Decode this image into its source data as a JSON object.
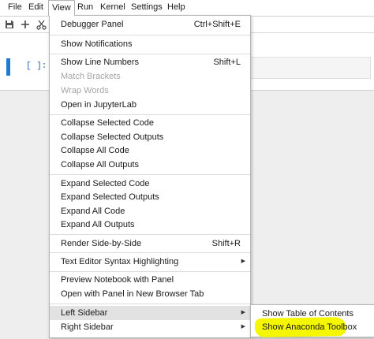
{
  "menubar": {
    "items": [
      "File",
      "Edit",
      "View",
      "Run",
      "Kernel",
      "Settings",
      "Help"
    ],
    "active": "View"
  },
  "toolbar": {
    "buttons": [
      {
        "icon": "save-icon"
      },
      {
        "icon": "plus-icon"
      },
      {
        "icon": "scissors-icon"
      }
    ]
  },
  "notebook": {
    "prompt": "[ ]:"
  },
  "view_menu": {
    "items": [
      {
        "label": "Debugger Panel",
        "shortcut": "Ctrl+Shift+E"
      },
      {
        "label": "Show Notifications"
      },
      {
        "label": "Show Line Numbers",
        "shortcut": "Shift+L"
      },
      {
        "label": "Match Brackets",
        "disabled": true
      },
      {
        "label": "Wrap Words",
        "disabled": true
      },
      {
        "label": "Open in JupyterLab"
      },
      {
        "label": "Collapse Selected Code"
      },
      {
        "label": "Collapse Selected Outputs"
      },
      {
        "label": "Collapse All Code"
      },
      {
        "label": "Collapse All Outputs"
      },
      {
        "label": "Expand Selected Code"
      },
      {
        "label": "Expand Selected Outputs"
      },
      {
        "label": "Expand All Code"
      },
      {
        "label": "Expand All Outputs"
      },
      {
        "label": "Render Side-by-Side",
        "shortcut": "Shift+R"
      },
      {
        "label": "Text Editor Syntax Highlighting",
        "submenu": true
      },
      {
        "label": "Preview Notebook with Panel"
      },
      {
        "label": "Open with Panel in New Browser Tab"
      },
      {
        "label": "Left Sidebar",
        "submenu": true,
        "highlighted": true
      },
      {
        "label": "Right Sidebar",
        "submenu": true
      }
    ]
  },
  "left_sidebar_submenu": {
    "items": [
      {
        "label": "Show Table of Contents"
      },
      {
        "label": "Show Anaconda Toolbox",
        "highlighted": true
      }
    ],
    "highlight_color": "#f4f700"
  }
}
